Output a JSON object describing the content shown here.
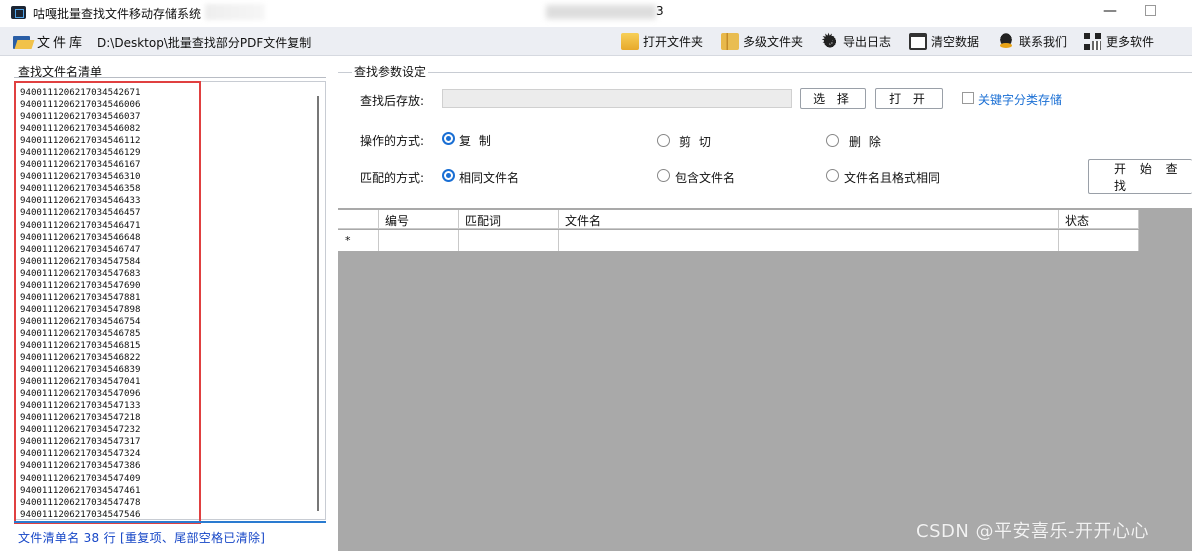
{
  "window": {
    "title": "咕嘎批量查找文件移动存储系统",
    "title_center_suffix": "3",
    "minimize_label": "—"
  },
  "toolbar": {
    "library_label": "文件库",
    "library_path": "D:\\Desktop\\批量查找部分PDF文件复制",
    "buttons": [
      {
        "label": "打开文件夹",
        "icon": "folder-icon"
      },
      {
        "label": "多级文件夹",
        "icon": "folders-icon"
      },
      {
        "label": "导出日志",
        "icon": "gear-icon"
      },
      {
        "label": "清空数据",
        "icon": "clipboard-icon"
      },
      {
        "label": "联系我们",
        "icon": "qq-icon"
      },
      {
        "label": "更多软件",
        "icon": "qrcode-icon"
      }
    ]
  },
  "left_panel": {
    "title": "查找文件名清单",
    "files": [
      "9400111206217034542671",
      "9400111206217034546006",
      "9400111206217034546037",
      "9400111206217034546082",
      "9400111206217034546112",
      "9400111206217034546129",
      "9400111206217034546167",
      "9400111206217034546310",
      "9400111206217034546358",
      "9400111206217034546433",
      "9400111206217034546457",
      "9400111206217034546471",
      "9400111206217034546648",
      "9400111206217034546747",
      "9400111206217034547584",
      "9400111206217034547683",
      "9400111206217034547690",
      "9400111206217034547881",
      "9400111206217034547898",
      "9400111206217034546754",
      "9400111206217034546785",
      "9400111206217034546815",
      "9400111206217034546822",
      "9400111206217034546839",
      "9400111206217034547041",
      "9400111206217034547096",
      "9400111206217034547133",
      "9400111206217034547218",
      "9400111206217034547232",
      "9400111206217034547317",
      "9400111206217034547324",
      "9400111206217034547386",
      "9400111206217034547409",
      "9400111206217034547461",
      "9400111206217034547478",
      "9400111206217034547546"
    ],
    "status": "文件清单名 38 行 [重复项、尾部空格已清除]"
  },
  "settings": {
    "group_title": "查找参数设定",
    "save_label": "查找后存放:",
    "save_value": "",
    "select_button": "选 择",
    "open_button": "打 开",
    "keyword_checkbox_label": "关键字分类存储",
    "keyword_checkbox_checked": false,
    "operation_label": "操作的方式:",
    "operation_options": [
      "复 制",
      "剪 切",
      "删 除"
    ],
    "operation_selected": 0,
    "match_label": "匹配的方式:",
    "match_options": [
      "相同文件名",
      "包含文件名",
      "文件名且格式相同"
    ],
    "match_selected": 0,
    "start_button": "开 始 查 找"
  },
  "grid": {
    "columns": [
      "编号",
      "匹配词",
      "文件名",
      "状态"
    ],
    "new_row_marker": "*"
  },
  "watermark": "CSDN @平安喜乐-开开心心",
  "colors": {
    "accent": "#1a6fd4",
    "status_text": "#1747c7",
    "highlight_box": "#e04040",
    "grid_background": "#a9a9a9"
  }
}
